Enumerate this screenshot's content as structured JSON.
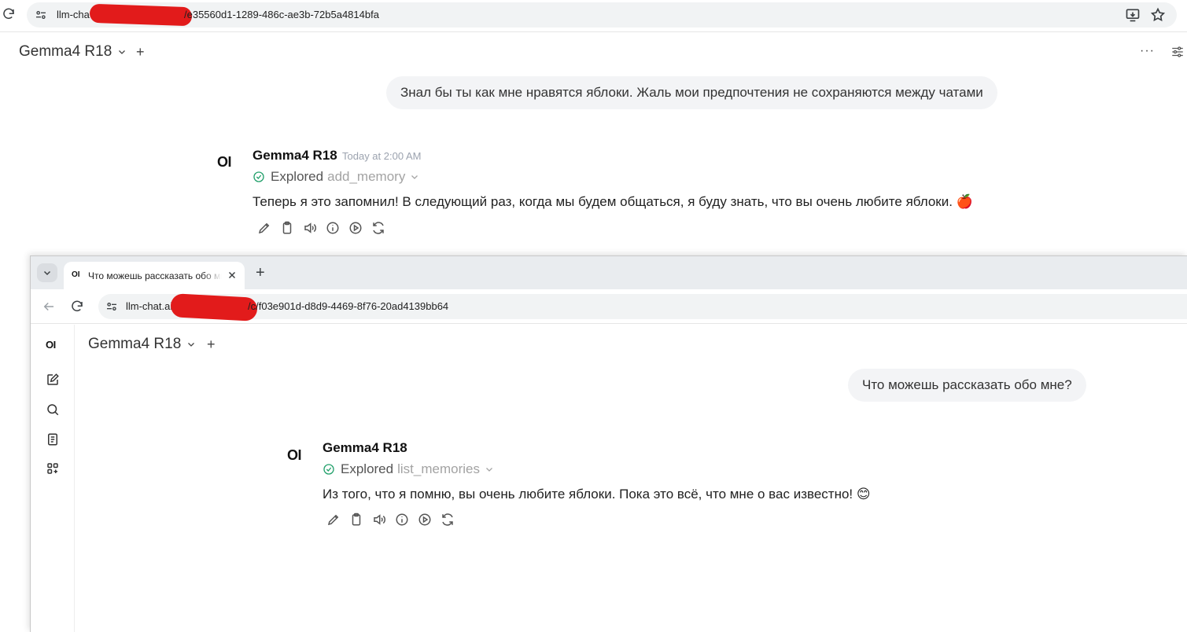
{
  "window1": {
    "url_prefix": "llm-cha",
    "url_suffix": "/e35560d1-1289-486c-ae3b-72b5a4814bfa",
    "model_name": "Gemma4 R18",
    "user_message": "Знал бы ты как мне нравятся яблоки. Жаль мои предпочтения не сохраняются между чатами",
    "assistant_logo": "OI",
    "assistant_name": "Gemma4 R18",
    "timestamp": "Today at 2:00 AM",
    "explored_label": "Explored",
    "tool_name": "add_memory",
    "answer": "Теперь я это запомнил! В следующий раз, когда мы будем общаться, я буду знать, что вы очень любите яблоки. 🍎",
    "more_label": "···"
  },
  "window2": {
    "tab_favicon": "OI",
    "tab_title": "Что можешь рассказать обо мне?",
    "url_prefix": "llm-chat.ai",
    "url_suffix": "/c/f03e901d-d8d9-4469-8f76-20ad4139bb64",
    "sidebar_logo": "OI",
    "model_name": "Gemma4 R18",
    "user_message": "Что можешь рассказать обо мне?",
    "assistant_logo": "OI",
    "assistant_name": "Gemma4 R18",
    "explored_label": "Explored",
    "tool_name": "list_memories",
    "answer": "Из того, что я помню, вы очень любите яблоки. Пока это всё, что мне о вас известно! 😊"
  },
  "common": {
    "plus": "+",
    "new_tab": "+"
  },
  "icons": [
    "reload-icon",
    "site-settings-icon",
    "install-app-icon",
    "star-icon",
    "chevron-down-icon",
    "controls-icon",
    "check-circle-icon",
    "edit-icon",
    "copy-icon",
    "speaker-icon",
    "info-icon",
    "play-icon",
    "regenerate-icon",
    "close-icon",
    "back-arrow-icon",
    "new-chat-icon",
    "search-icon",
    "notes-icon",
    "workspace-icon"
  ],
  "colors": {
    "redaction": "#e21b1b",
    "success": "#22a06b",
    "bubble": "#f3f4f6"
  }
}
